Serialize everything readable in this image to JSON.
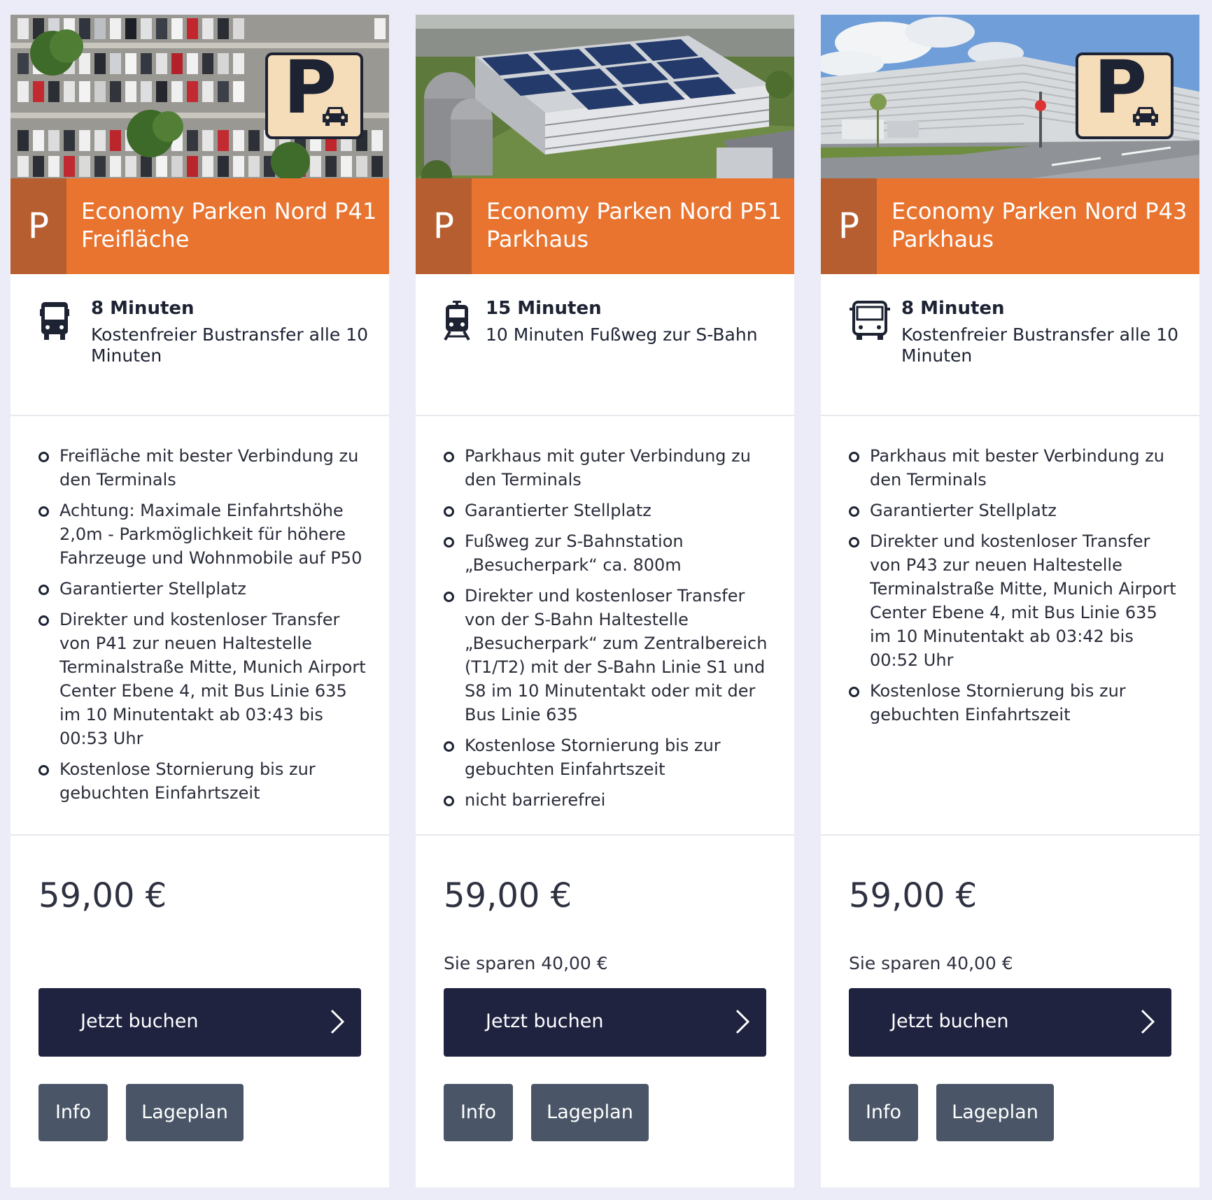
{
  "cards": [
    {
      "title_line1": "Economy Parken Nord P41",
      "title_line2": "Freifläche",
      "p_tile": "P",
      "image": "parking-lot-photo",
      "transfer_icon": "bus-icon",
      "transfer_time": "8 Minuten",
      "transfer_desc": "Kostenfreier Bustransfer alle 10 Minuten",
      "features": [
        "Freifläche mit bester Verbindung zu den Terminals",
        "Achtung: Maximale Einfahrtshöhe 2,0m - Parkmöglichkeit für höhere Fahrzeuge und Wohnmobile auf P50",
        "Garantierter Stellplatz",
        "Direkter und kostenloser Transfer von P41 zur neuen Haltestelle Terminalstraße Mitte, Munich Airport Center Ebene 4, mit Bus Linie 635 im 10 Minutentakt ab 03:43 bis 00:53 Uhr",
        "Kostenlose Stornierung bis zur gebuchten Einfahrtszeit"
      ],
      "price": "59,00 €",
      "savings": "",
      "book_label": "Jetzt buchen",
      "info_label": "Info",
      "map_label": "Lageplan"
    },
    {
      "title_line1": "Economy Parken Nord P51",
      "title_line2": "Parkhaus",
      "p_tile": "P",
      "image": "parking-garage-aerial-photo",
      "transfer_icon": "train-icon",
      "transfer_time": "15 Minuten",
      "transfer_desc": "10 Minuten Fußweg zur S-Bahn",
      "features": [
        "Parkhaus mit guter Verbindung zu den Terminals",
        "Garantierter Stellplatz",
        "Fußweg zur S-Bahnstation „Besucherpark“ ca. 800m",
        "Direkter und kostenloser Transfer von der S-Bahn Haltestelle „Besucherpark“ zum Zentralbereich (T1/T2) mit der S-Bahn Linie S1 und S8 im 10 Minutentakt oder mit der Bus Linie 635",
        "Kostenlose Stornierung bis zur gebuchten Einfahrtszeit",
        "nicht barrierefrei"
      ],
      "price": "59,00 €",
      "savings": "Sie sparen 40,00 €",
      "book_label": "Jetzt buchen",
      "info_label": "Info",
      "map_label": "Lageplan"
    },
    {
      "title_line1": "Economy Parken Nord P43",
      "title_line2": "Parkhaus",
      "p_tile": "P",
      "image": "parking-garage-street-photo",
      "transfer_icon": "bus-icon",
      "transfer_time": "8 Minuten",
      "transfer_desc": "Kostenfreier Bustransfer alle 10 Minuten",
      "features": [
        "Parkhaus mit bester Verbindung zu den Terminals",
        "Garantierter Stellplatz",
        "Direkter und kostenloser Transfer von P43 zur neuen Haltestelle Terminalstraße Mitte, Munich Airport Center Ebene 4, mit Bus Linie 635 im 10 Minutentakt ab 03:42 bis 00:52 Uhr",
        "Kostenlose Stornierung bis zur gebuchten Einfahrtszeit"
      ],
      "price": "59,00 €",
      "savings": "Sie sparen 40,00 €",
      "book_label": "Jetzt buchen",
      "info_label": "Info",
      "map_label": "Lageplan"
    }
  ],
  "colors": {
    "page_bg": "#ebecf7",
    "title_orange": "#e87430",
    "p_tile_brown": "#b65e30",
    "button_navy": "#1f2340",
    "button_slate": "#4a5667",
    "sign_cream": "#f6ddb9"
  }
}
